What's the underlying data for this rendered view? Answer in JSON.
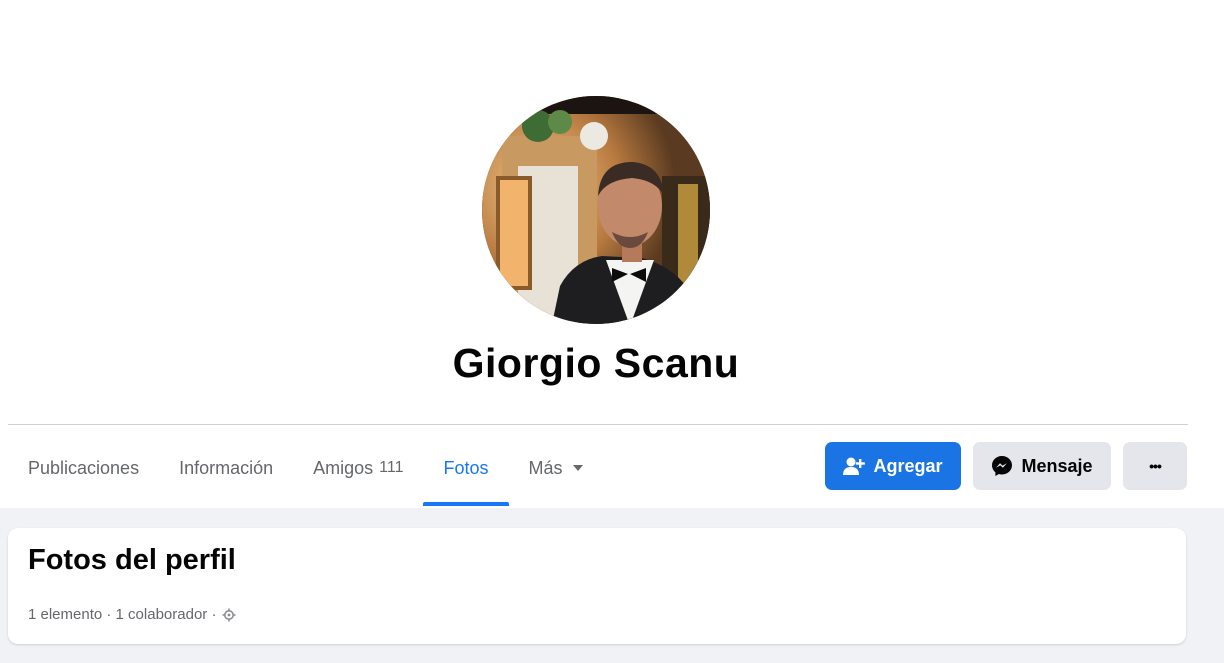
{
  "profile": {
    "name": "Giorgio Scanu"
  },
  "tabs": [
    {
      "label": "Publicaciones",
      "count": ""
    },
    {
      "label": "Información",
      "count": ""
    },
    {
      "label": "Amigos",
      "count": "111"
    },
    {
      "label": "Fotos",
      "count": ""
    },
    {
      "label": "Más",
      "count": ""
    }
  ],
  "actions": {
    "add_label": "Agregar",
    "message_label": "Mensaje",
    "more_label": "•••"
  },
  "album": {
    "title": "Fotos del perfil",
    "meta": "1 elemento · 1 colaborador ·"
  },
  "icons": {
    "add_friend": "person-plus-icon",
    "messenger": "messenger-icon",
    "dropdown": "caret-down-icon",
    "privacy": "gear-icon"
  },
  "colors": {
    "accent": "#1877f2",
    "primary_button": "#1b74e4",
    "secondary_button": "#e4e6eb",
    "muted_text": "#65676b",
    "feed_background": "#f0f2f5"
  }
}
